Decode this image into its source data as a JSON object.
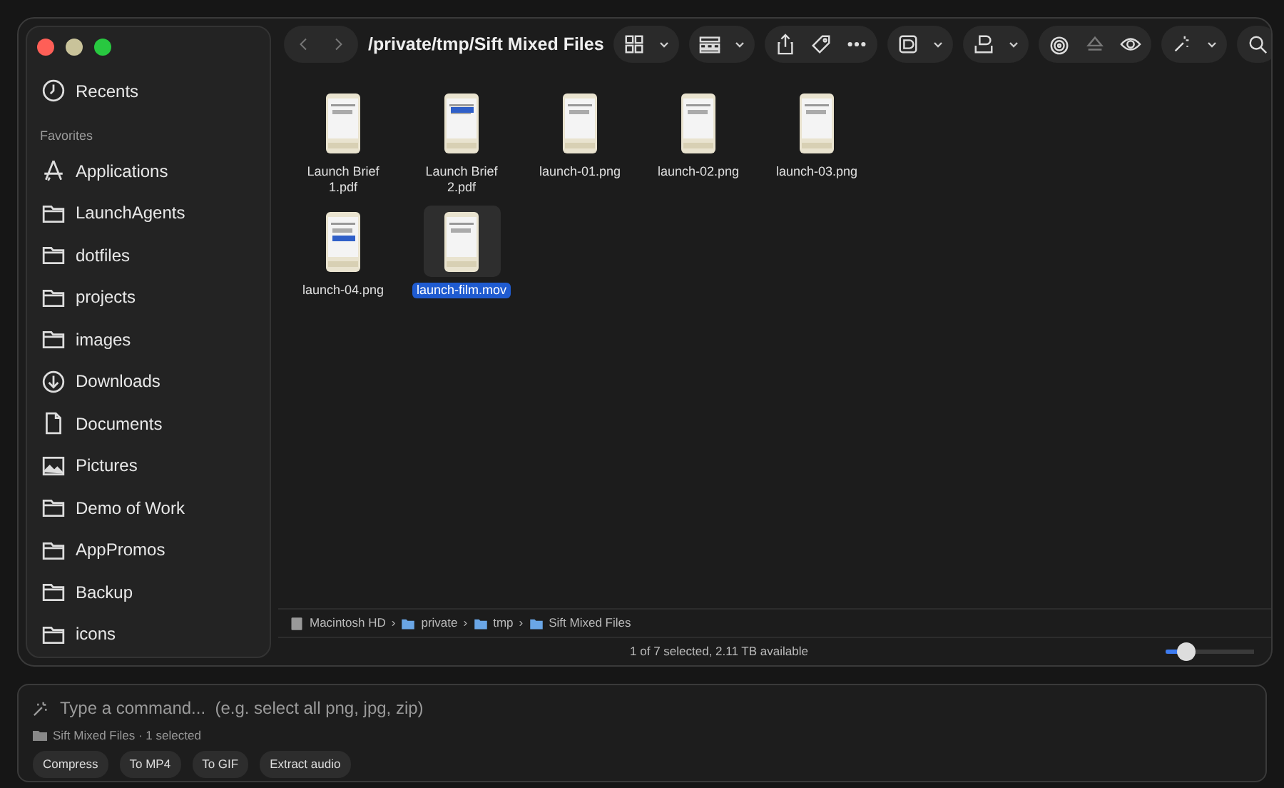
{
  "window": {
    "title": "/private/tmp/Sift Mixed Files"
  },
  "sidebar": {
    "top": [
      {
        "label": "Recents",
        "kind": "recents"
      }
    ],
    "section": "Favorites",
    "items": [
      {
        "label": "Applications",
        "kind": "apps"
      },
      {
        "label": "LaunchAgents",
        "kind": "folder"
      },
      {
        "label": "dotfiles",
        "kind": "folder"
      },
      {
        "label": "projects",
        "kind": "folder"
      },
      {
        "label": "images",
        "kind": "folder"
      },
      {
        "label": "Downloads",
        "kind": "download"
      },
      {
        "label": "Documents",
        "kind": "document"
      },
      {
        "label": "Pictures",
        "kind": "pictures"
      },
      {
        "label": "Demo of Work",
        "kind": "folder"
      },
      {
        "label": "AppPromos",
        "kind": "folder"
      },
      {
        "label": "Backup",
        "kind": "folder"
      },
      {
        "label": "icons",
        "kind": "folder"
      }
    ]
  },
  "files": [
    {
      "name": "Launch Brief 1.pdf",
      "selected": false
    },
    {
      "name": "Launch Brief 2.pdf",
      "selected": false
    },
    {
      "name": "launch-01.png",
      "selected": false
    },
    {
      "name": "launch-02.png",
      "selected": false
    },
    {
      "name": "launch-03.png",
      "selected": false
    },
    {
      "name": "launch-04.png",
      "selected": false
    },
    {
      "name": "launch-film.mov",
      "selected": true
    }
  ],
  "path_bar": [
    {
      "label": "Macintosh HD",
      "kind": "disk"
    },
    {
      "label": "private",
      "kind": "folder"
    },
    {
      "label": "tmp",
      "kind": "folder"
    },
    {
      "label": "Sift Mixed Files",
      "kind": "folder"
    }
  ],
  "path_separator": "›",
  "status_bar": {
    "text": "1 of 7 selected, 2.11 TB available",
    "zoom": {
      "level": 0.25
    }
  },
  "command_bar": {
    "placeholder": "Type a command...  (e.g. select all png, jpg, zip)",
    "context": "Sift Mixed Files · 1 selected",
    "actions": [
      "Compress",
      "To MP4",
      "To GIF",
      "Extract audio"
    ]
  }
}
